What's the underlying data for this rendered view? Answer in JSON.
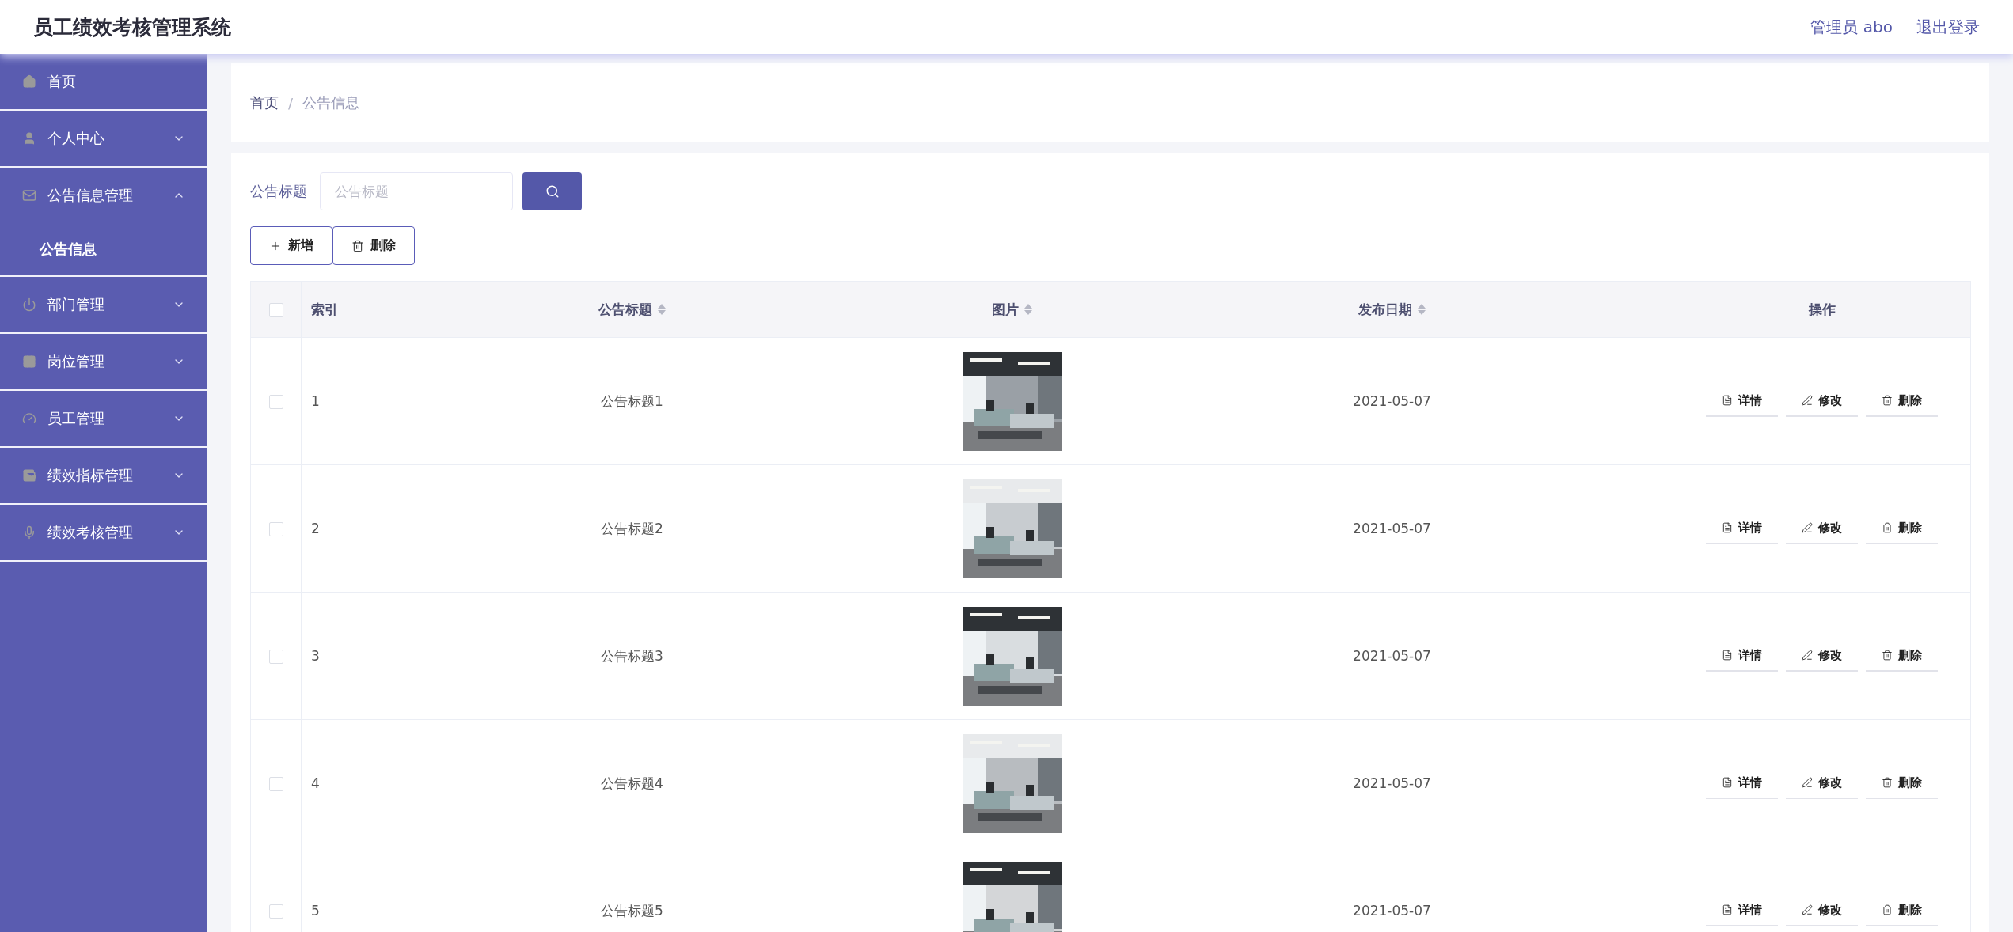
{
  "header": {
    "title": "员工绩效考核管理系统",
    "user": "管理员 abo",
    "logout": "退出登录"
  },
  "sidebar": {
    "items": [
      {
        "label": "首页",
        "expanded": false,
        "has_children": false
      },
      {
        "label": "个人中心",
        "expanded": false,
        "has_children": true
      },
      {
        "label": "公告信息管理",
        "expanded": true,
        "has_children": true,
        "children": [
          {
            "label": "公告信息",
            "selected": true
          }
        ]
      },
      {
        "label": "部门管理",
        "expanded": false,
        "has_children": true
      },
      {
        "label": "岗位管理",
        "expanded": false,
        "has_children": true
      },
      {
        "label": "员工管理",
        "expanded": false,
        "has_children": true
      },
      {
        "label": "绩效指标管理",
        "expanded": false,
        "has_children": true
      },
      {
        "label": "绩效考核管理",
        "expanded": false,
        "has_children": true
      }
    ]
  },
  "breadcrumb": {
    "items": [
      "首页",
      "公告信息"
    ],
    "separator": "/"
  },
  "search": {
    "label": "公告标题",
    "placeholder": "公告标题"
  },
  "actions": [
    "新增",
    "删除"
  ],
  "table": {
    "columns": [
      {
        "label": "索引",
        "sortable": false
      },
      {
        "label": "公告标题",
        "sortable": true
      },
      {
        "label": "图片",
        "sortable": true
      },
      {
        "label": "发布日期",
        "sortable": true
      },
      {
        "label": "操作",
        "sortable": false
      }
    ],
    "header_checked": false,
    "rows": [
      {
        "index": "1",
        "title": "公告标题1",
        "date": "2021-05-07",
        "selected": false,
        "actions": [
          "详情",
          "修改",
          "删除"
        ]
      },
      {
        "index": "2",
        "title": "公告标题2",
        "date": "2021-05-07",
        "selected": false,
        "actions": [
          "详情",
          "修改",
          "删除"
        ]
      },
      {
        "index": "3",
        "title": "公告标题3",
        "date": "2021-05-07",
        "selected": false,
        "actions": [
          "详情",
          "修改",
          "删除"
        ]
      },
      {
        "index": "4",
        "title": "公告标题4",
        "date": "2021-05-07",
        "selected": false,
        "actions": [
          "详情",
          "修改",
          "删除"
        ]
      },
      {
        "index": "5",
        "title": "公告标题5",
        "date": "2021-05-07",
        "selected": false,
        "actions": [
          "详情",
          "修改",
          "删除"
        ]
      }
    ]
  }
}
